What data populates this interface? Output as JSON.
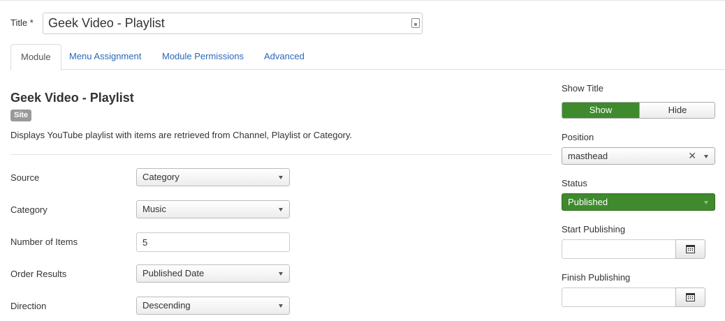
{
  "title_field": {
    "label": "Title *",
    "value": "Geek Video - Playlist"
  },
  "tabs": [
    {
      "label": "Module"
    },
    {
      "label": "Menu Assignment"
    },
    {
      "label": "Module Permissions"
    },
    {
      "label": "Advanced"
    }
  ],
  "module": {
    "heading": "Geek Video - Playlist",
    "badge": "Site",
    "description": "Displays YouTube playlist with items are retrieved from Channel, Playlist or Category."
  },
  "fields": {
    "source": {
      "label": "Source",
      "value": "Category"
    },
    "category": {
      "label": "Category",
      "value": "Music"
    },
    "number_of_items": {
      "label": "Number of Items",
      "value": "5"
    },
    "order_results": {
      "label": "Order Results",
      "value": "Published Date"
    },
    "direction": {
      "label": "Direction",
      "value": "Descending"
    }
  },
  "sidebar": {
    "show_title": {
      "label": "Show Title",
      "options": [
        "Show",
        "Hide"
      ],
      "selected": "Show"
    },
    "position": {
      "label": "Position",
      "value": "masthead"
    },
    "status": {
      "label": "Status",
      "value": "Published"
    },
    "start_publishing": {
      "label": "Start Publishing",
      "value": ""
    },
    "finish_publishing": {
      "label": "Finish Publishing",
      "value": ""
    }
  },
  "colors": {
    "accent_green": "#3e8a2d",
    "link_blue": "#2a69b8"
  },
  "icons": {
    "title_field": "editor-icon",
    "calendar": "calendar-icon",
    "clear": "clear-x-icon",
    "caret": "chevron-down-icon"
  }
}
